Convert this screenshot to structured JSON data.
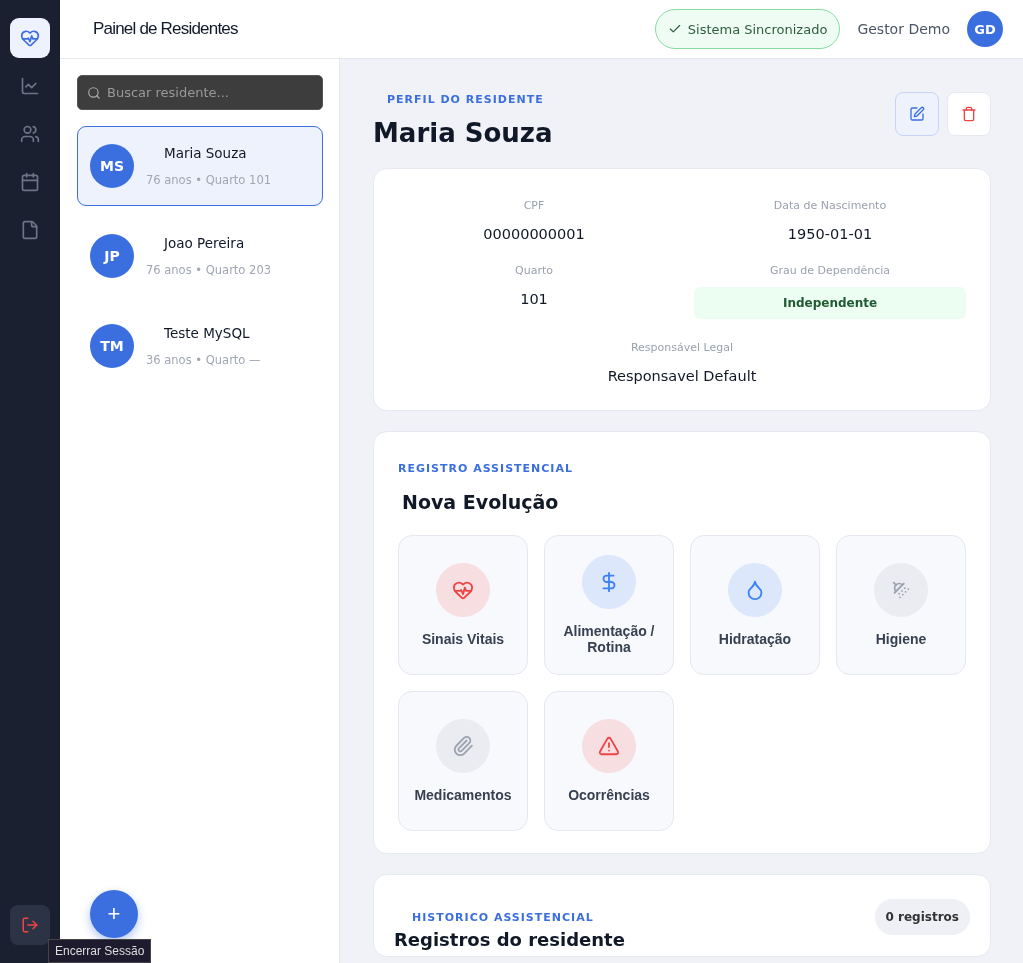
{
  "nav": [
    {
      "kind": "heart-pulse",
      "selected": true
    },
    {
      "kind": "chart",
      "selected": false
    },
    {
      "kind": "users",
      "selected": false
    },
    {
      "kind": "calendar",
      "selected": false
    },
    {
      "kind": "file",
      "selected": false
    }
  ],
  "logout": {
    "tooltip": "Encerrar Sessão"
  },
  "header": {
    "title": "Painel de Residentes",
    "status": "Sistema Sincronizado",
    "user": "Gestor Demo",
    "user_initials": "GD"
  },
  "search": {
    "placeholder": "Buscar residente..."
  },
  "residents": [
    {
      "initials": "MS",
      "name": "Maria Souza",
      "meta": "76 anos • Quarto 101",
      "selected": true
    },
    {
      "initials": "JP",
      "name": "Joao Pereira",
      "meta": "76 anos • Quarto 203",
      "selected": false
    },
    {
      "initials": "TM",
      "name": "Teste MySQL",
      "meta": "36 anos • Quarto —",
      "selected": false
    }
  ],
  "add_button": "+",
  "profile": {
    "eyebrow": "PERFIL DO RESIDENTE",
    "name": "Maria Souza",
    "fields": [
      {
        "label": "CPF",
        "value": "00000000001",
        "kind": "text"
      },
      {
        "label": "Data de Nascimento",
        "value": "1950-01-01",
        "kind": "text"
      },
      {
        "label": "Quarto",
        "value": "101",
        "kind": "text"
      },
      {
        "label": "Grau de Dependência",
        "value": "Independente",
        "kind": "badge"
      },
      {
        "label": "Responsável Legal",
        "value": "Responsavel Default",
        "kind": "wide"
      }
    ]
  },
  "evolution": {
    "eyebrow": "REGISTRO ASSISTENCIAL",
    "title": "Nova Evolução",
    "tiles": [
      {
        "label": "Sinais Vitais",
        "kind": "heart",
        "color": "#ef4444"
      },
      {
        "label": "Alimentação / Rotina",
        "kind": "dollar",
        "color": "#3b82f6"
      },
      {
        "label": "Hidratação",
        "kind": "drop",
        "color": "#3b82f6"
      },
      {
        "label": "Higiene",
        "kind": "shower",
        "color": "#9ca3af"
      },
      {
        "label": "Medicamentos",
        "kind": "clip",
        "color": "#9ca3af"
      },
      {
        "label": "Ocorrências",
        "kind": "alert",
        "color": "#ef4444"
      }
    ]
  },
  "history": {
    "eyebrow": "HISTORICO ASSISTENCIAL",
    "title": "Registros do residente",
    "count": "0 registros"
  }
}
